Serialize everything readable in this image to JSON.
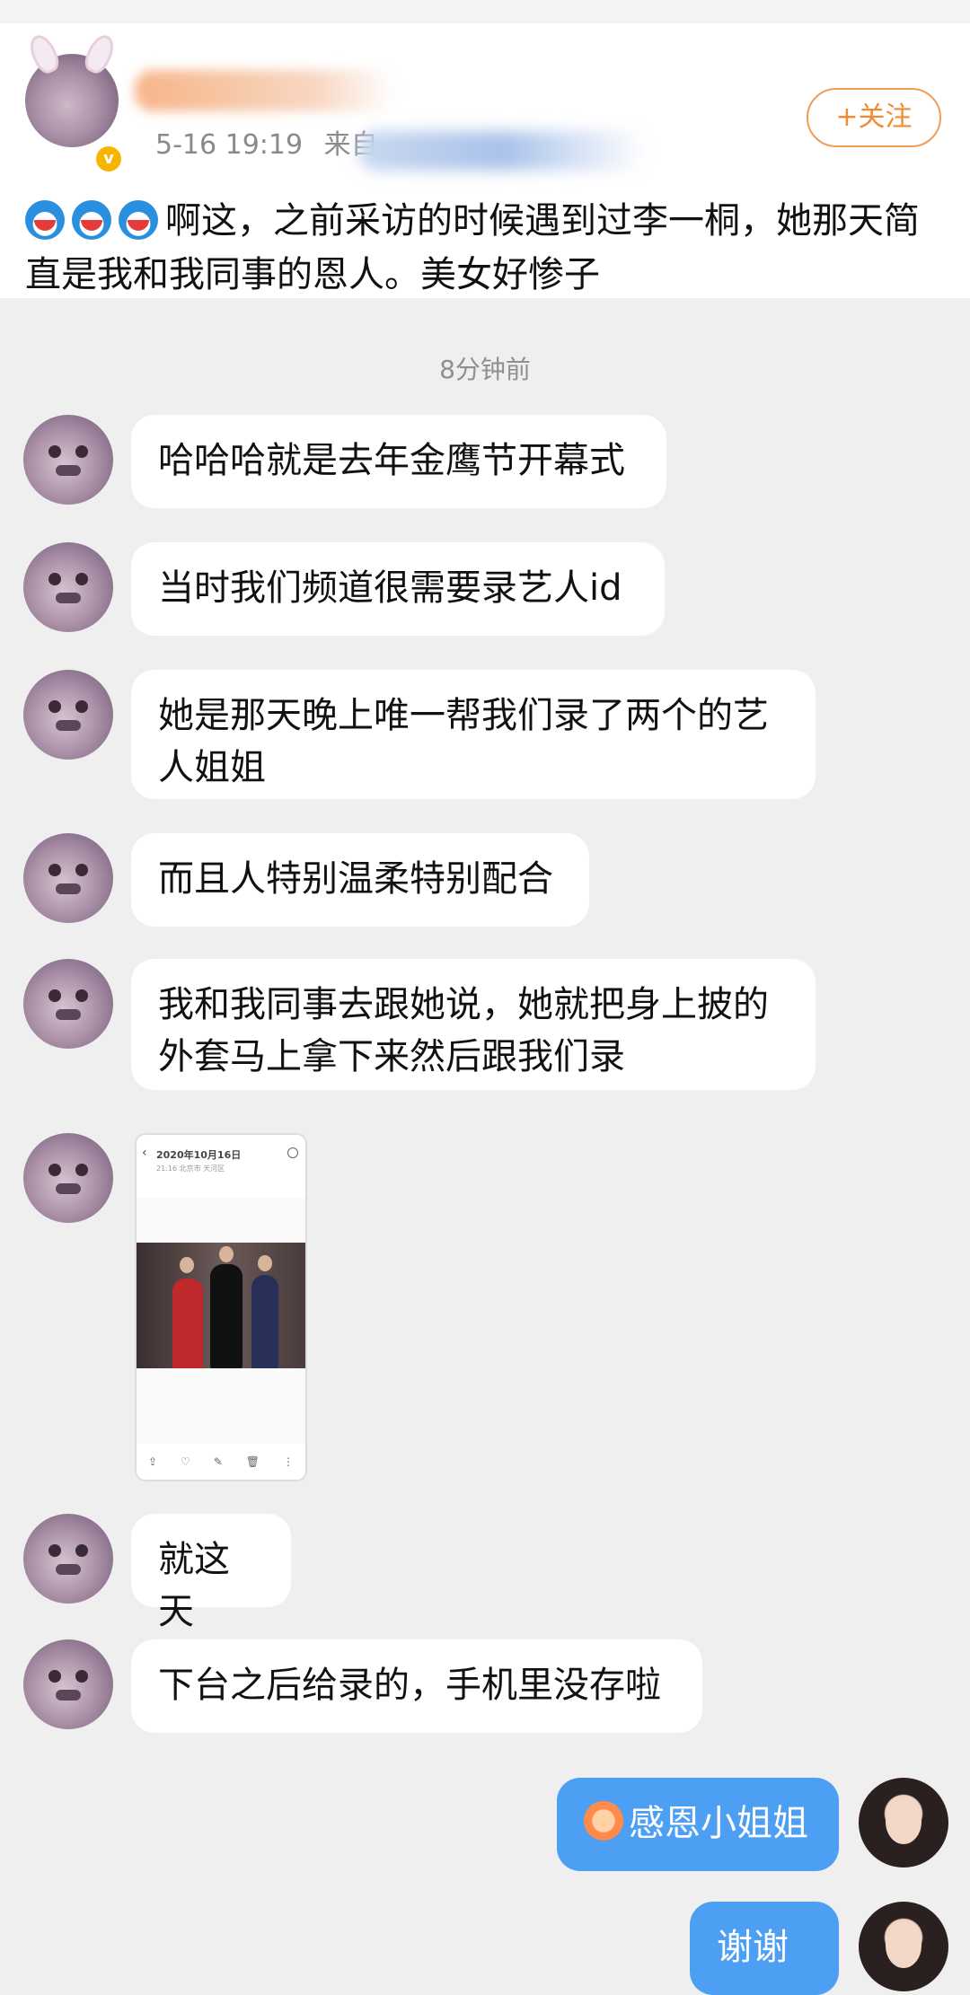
{
  "post": {
    "time": "5-16 19:19",
    "source_prefix": "来自",
    "follow_label": "+关注",
    "text": "啊这，之前采访的时候遇到过李一桐，她那天简直是我和我同事的恩人。美女好惨子"
  },
  "chat": {
    "timestamp": "8分钟前",
    "messages": [
      "哈哈哈就是去年金鹰节开幕式",
      "当时我们频道很需要录艺人id",
      "她是那天晚上唯一帮我们录了两个的艺人姐姐",
      "而且人特别温柔特别配合",
      "我和我同事去跟她说，她就把身上披的外套马上拿下来然后跟我们录",
      "就这天",
      "下台之后给录的，手机里没存啦"
    ],
    "image_preview": {
      "date": "2020年10月16日",
      "subtitle": "21:16 北京市 天河区"
    },
    "my_messages": [
      "感恩小姐姐",
      "谢谢"
    ]
  }
}
